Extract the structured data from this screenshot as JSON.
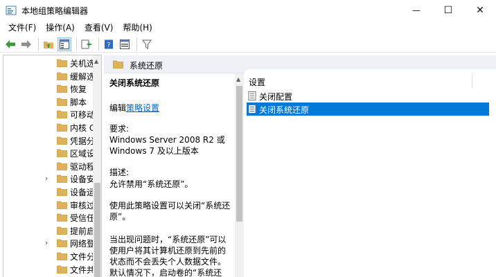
{
  "window": {
    "title": "本地组策略编辑器",
    "minimize_glyph": "—",
    "maximize_glyph": "☐",
    "close_glyph": "✕"
  },
  "menu": [
    "文件(F)",
    "操作(A)",
    "查看(V)",
    "帮助(H)"
  ],
  "toolbar": {
    "icons": [
      "back-arrow-icon",
      "forward-arrow-icon",
      "folder-up-icon",
      "show-hide-tree-icon",
      "export-list-icon",
      "help-icon",
      "properties-icon",
      "filter-icon"
    ]
  },
  "tree": {
    "items": [
      {
        "label": "关机选",
        "expandable": false
      },
      {
        "label": "缓解选",
        "expandable": false
      },
      {
        "label": "恢复",
        "expandable": false
      },
      {
        "label": "脚本",
        "expandable": false
      },
      {
        "label": "可移动",
        "expandable": false
      },
      {
        "label": "内核 C",
        "expandable": false
      },
      {
        "label": "凭据分",
        "expandable": false
      },
      {
        "label": "区域设",
        "expandable": false
      },
      {
        "label": "驱动程",
        "expandable": false
      },
      {
        "label": "设备安",
        "expandable": true
      },
      {
        "label": "设备运",
        "expandable": false
      },
      {
        "label": "审核过",
        "expandable": false
      },
      {
        "label": "受信任",
        "expandable": false
      },
      {
        "label": "提前启",
        "expandable": false
      },
      {
        "label": "网络登",
        "expandable": true
      },
      {
        "label": "文件分",
        "expandable": false
      },
      {
        "label": "文件共",
        "expandable": false
      }
    ]
  },
  "panel": {
    "folder_title": "系统还原",
    "policy_title": "关闭系统还原",
    "edit_prefix": "编辑",
    "edit_link": "策略设置",
    "requirements_label": "要求:",
    "requirements_text": "Windows Server 2008 R2 或 Windows 7 及以上版本",
    "description_label": "描述:",
    "description_text": "允许禁用“系统还原”。",
    "para1": "使用此策略设置可以关闭“系统还原”。",
    "para2": "当出现问题时，“系统还原”可以使用户将其计算机还原到先前的状态而不会丢失个人数据文件。默认情况下，启动卷的“系统还原”为启用"
  },
  "settings": {
    "column_header": "设置",
    "rows": [
      {
        "label": "关闭配置",
        "selected": false
      },
      {
        "label": "关闭系统还原",
        "selected": true
      }
    ]
  },
  "colors": {
    "selection": "#0078d7",
    "link": "#0066cc",
    "folder": "#dcb35c",
    "header_band": "#eef0f6"
  }
}
